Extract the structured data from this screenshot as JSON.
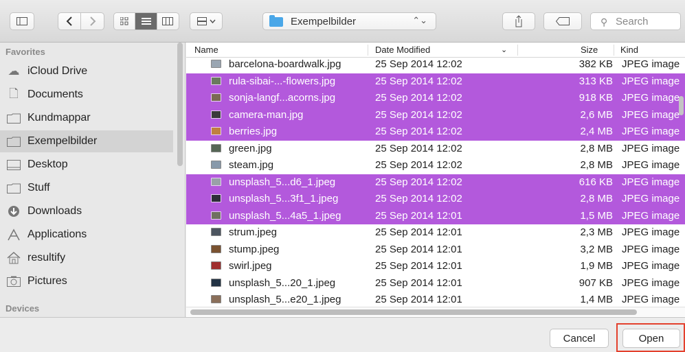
{
  "toolbar": {
    "path_label": "Exempelbilder",
    "search_placeholder": "Search"
  },
  "sidebar": {
    "favorites_header": "Favorites",
    "devices_header": "Devices",
    "items": [
      {
        "label": "iCloud Drive",
        "icon": "cloud-icon"
      },
      {
        "label": "Documents",
        "icon": "documents-icon"
      },
      {
        "label": "Kundmappar",
        "icon": "folder-icon"
      },
      {
        "label": "Exempelbilder",
        "icon": "folder-icon",
        "selected": true
      },
      {
        "label": "Desktop",
        "icon": "desktop-icon"
      },
      {
        "label": "Stuff",
        "icon": "folder-icon"
      },
      {
        "label": "Downloads",
        "icon": "downloads-icon"
      },
      {
        "label": "Applications",
        "icon": "applications-icon"
      },
      {
        "label": "resultify",
        "icon": "home-icon"
      },
      {
        "label": "Pictures",
        "icon": "pictures-icon"
      }
    ]
  },
  "columns": {
    "name": "Name",
    "date": "Date Modified",
    "size": "Size",
    "kind": "Kind"
  },
  "files": [
    {
      "name": "barcelona-boardwalk.jpg",
      "date": "25 Sep 2014 12:02",
      "size": "382 KB",
      "kind": "JPEG image",
      "selected": false,
      "thumb": "#9aa6b2"
    },
    {
      "name": "rula-sibai-...-flowers.jpg",
      "date": "25 Sep 2014 12:02",
      "size": "313 KB",
      "kind": "JPEG image",
      "selected": true,
      "thumb": "#6a7a5e"
    },
    {
      "name": "sonja-langf...acorns.jpg",
      "date": "25 Sep 2014 12:02",
      "size": "918 KB",
      "kind": "JPEG image",
      "selected": true,
      "thumb": "#7b6a55"
    },
    {
      "name": "camera-man.jpg",
      "date": "25 Sep 2014 12:02",
      "size": "2,6 MB",
      "kind": "JPEG image",
      "selected": true,
      "thumb": "#3a3a3a"
    },
    {
      "name": "berries.jpg",
      "date": "25 Sep 2014 12:02",
      "size": "2,4 MB",
      "kind": "JPEG image",
      "selected": true,
      "thumb": "#c08040"
    },
    {
      "name": "green.jpg",
      "date": "25 Sep 2014 12:02",
      "size": "2,8 MB",
      "kind": "JPEG image",
      "selected": false,
      "thumb": "#556655"
    },
    {
      "name": "steam.jpg",
      "date": "25 Sep 2014 12:02",
      "size": "2,8 MB",
      "kind": "JPEG image",
      "selected": false,
      "thumb": "#8899aa"
    },
    {
      "name": "unsplash_5...d6_1.jpeg",
      "date": "25 Sep 2014 12:02",
      "size": "616 KB",
      "kind": "JPEG image",
      "selected": true,
      "thumb": "#9aa0a8"
    },
    {
      "name": "unsplash_5...3f1_1.jpeg",
      "date": "25 Sep 2014 12:02",
      "size": "2,8 MB",
      "kind": "JPEG image",
      "selected": true,
      "thumb": "#2e2e38"
    },
    {
      "name": "unsplash_5...4a5_1.jpeg",
      "date": "25 Sep 2014 12:01",
      "size": "1,5 MB",
      "kind": "JPEG image",
      "selected": true,
      "thumb": "#707060"
    },
    {
      "name": "strum.jpeg",
      "date": "25 Sep 2014 12:01",
      "size": "2,3 MB",
      "kind": "JPEG image",
      "selected": false,
      "thumb": "#4c5560"
    },
    {
      "name": "stump.jpeg",
      "date": "25 Sep 2014 12:01",
      "size": "3,2 MB",
      "kind": "JPEG image",
      "selected": false,
      "thumb": "#7a5230"
    },
    {
      "name": "swirl.jpeg",
      "date": "25 Sep 2014 12:01",
      "size": "1,9 MB",
      "kind": "JPEG image",
      "selected": false,
      "thumb": "#a03030"
    },
    {
      "name": "unsplash_5...20_1.jpeg",
      "date": "25 Sep 2014 12:01",
      "size": "907 KB",
      "kind": "JPEG image",
      "selected": false,
      "thumb": "#223344"
    },
    {
      "name": "unsplash_5...e20_1.jpeg",
      "date": "25 Sep 2014 12:01",
      "size": "1,4 MB",
      "kind": "JPEG image",
      "selected": false,
      "thumb": "#8a6f5a"
    }
  ],
  "buttons": {
    "cancel": "Cancel",
    "open": "Open"
  },
  "colors": {
    "selection": "#b359dc",
    "highlight_outline": "#e3402d",
    "folder_blue": "#4aa7e8"
  }
}
